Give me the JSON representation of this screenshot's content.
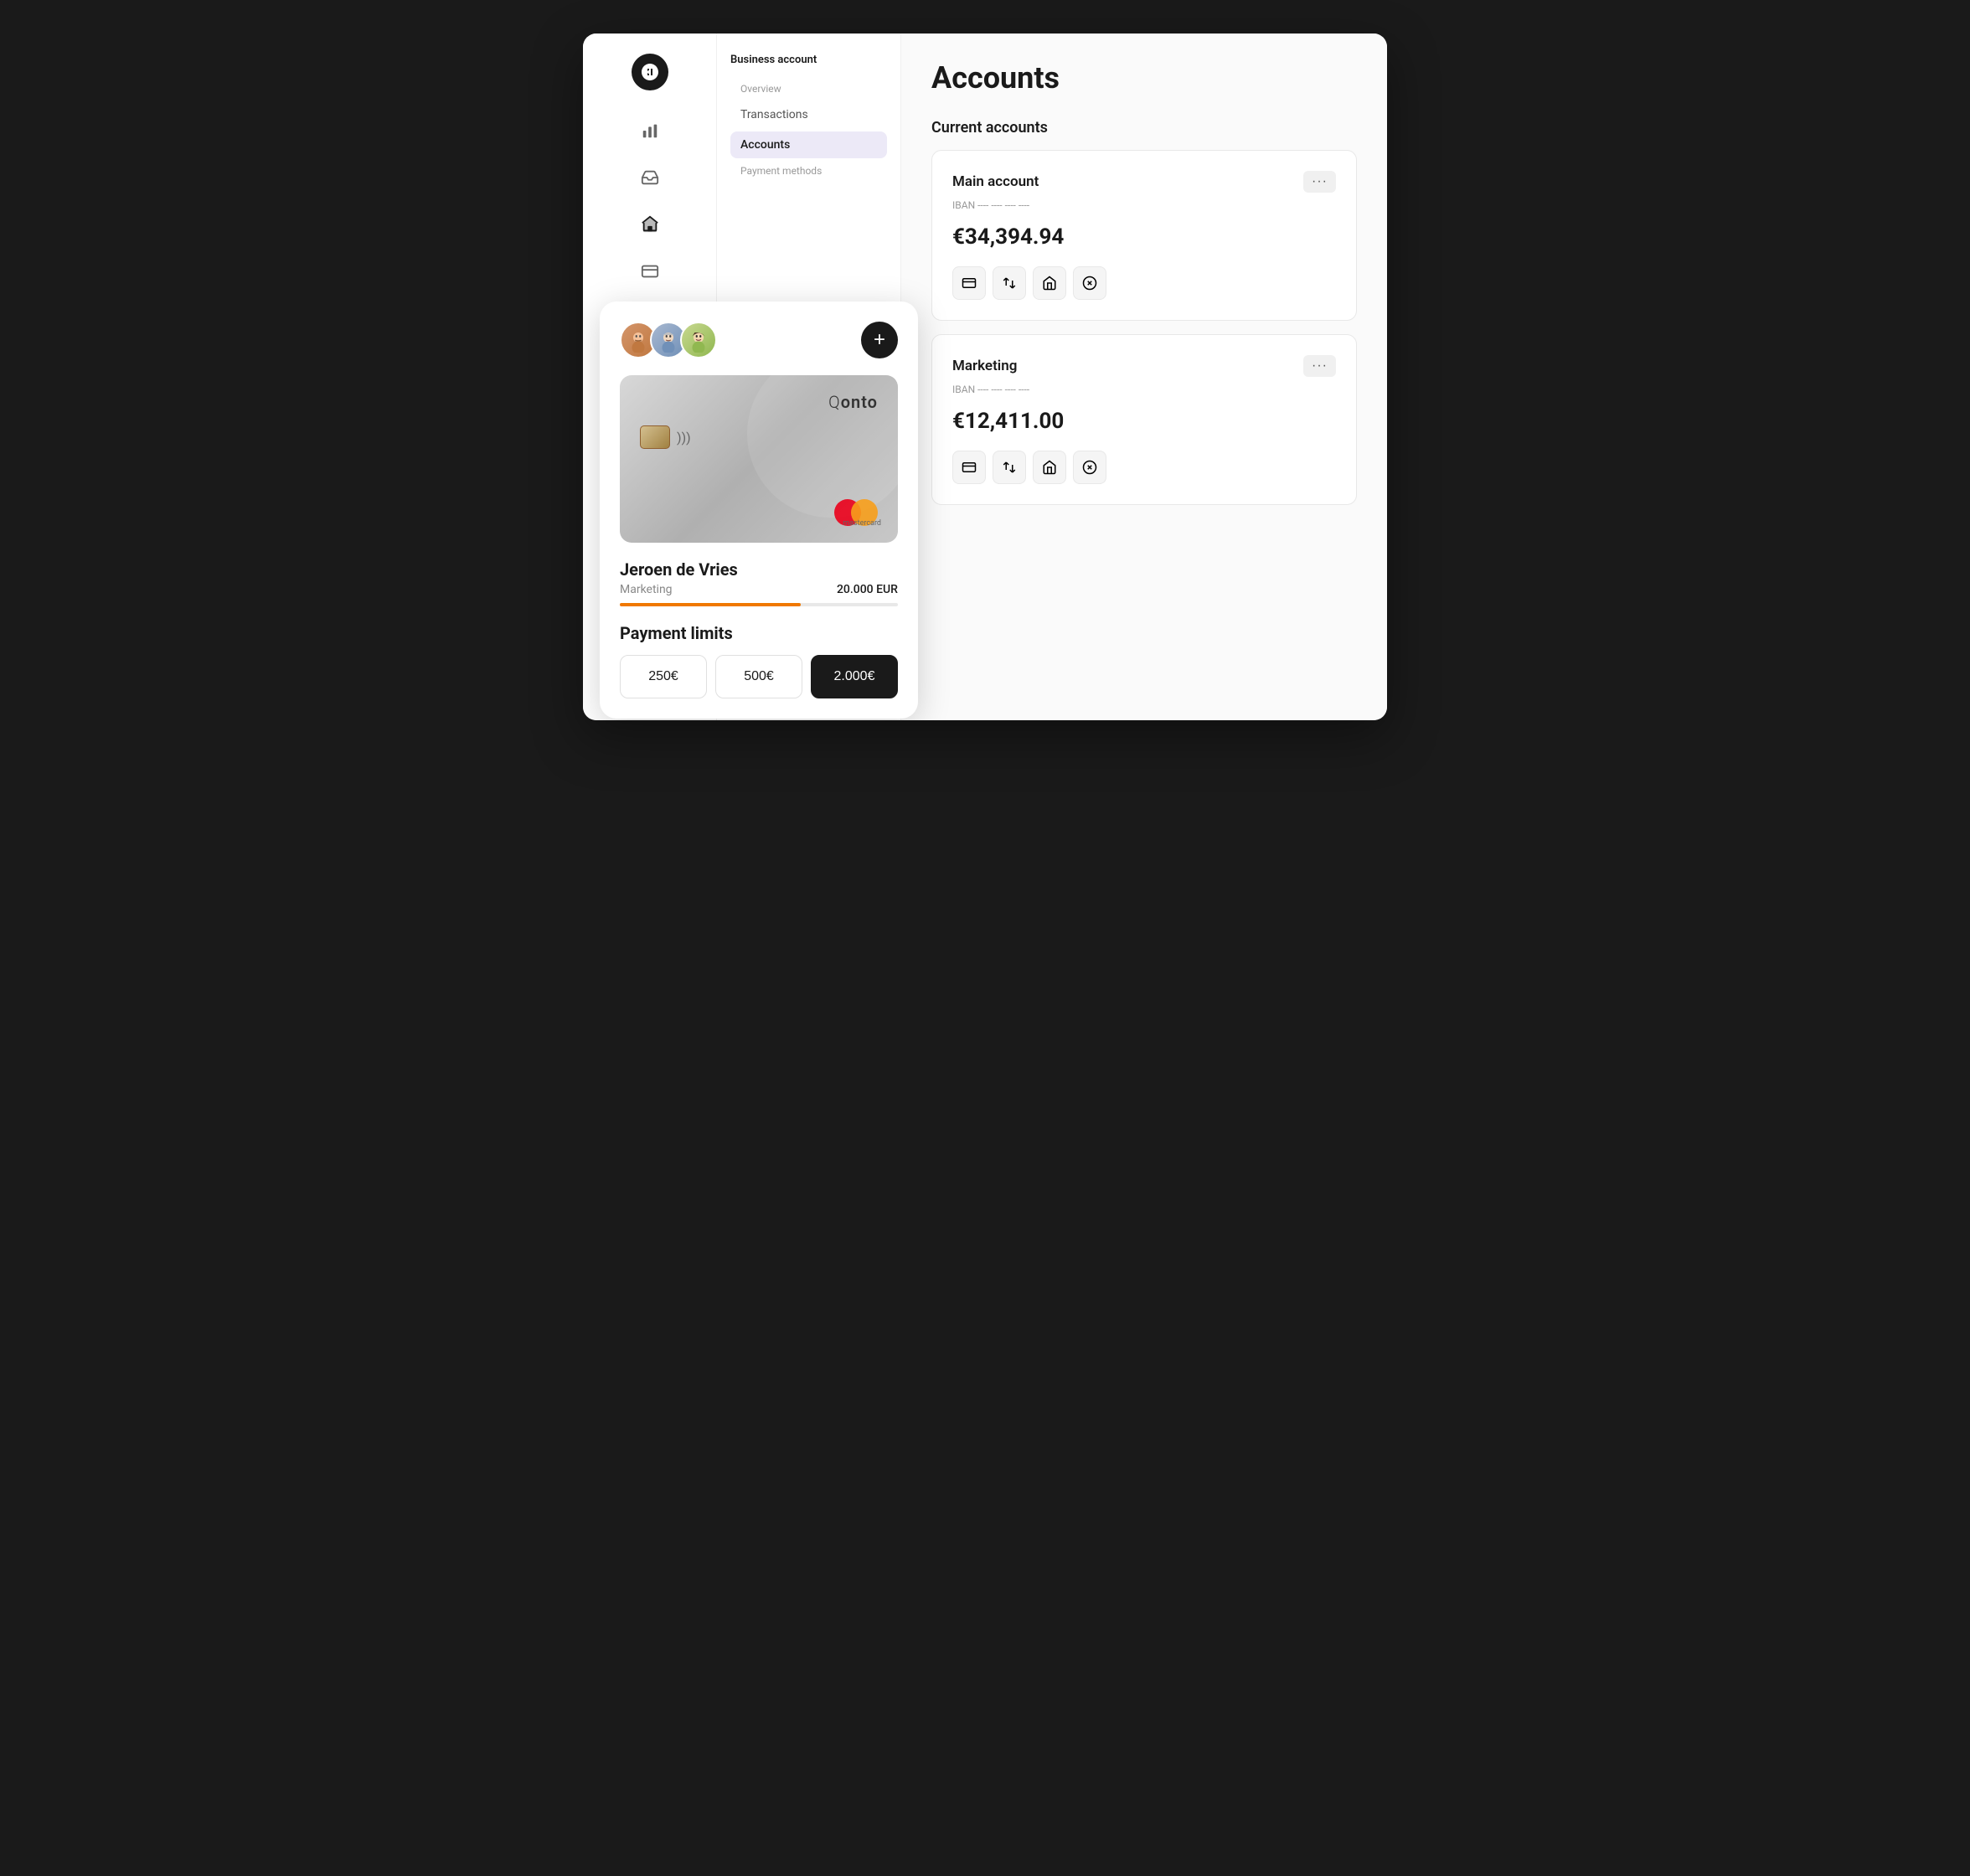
{
  "sidebar": {
    "logo_label": "Qonto logo",
    "items": [
      {
        "name": "analytics",
        "icon": "bar-chart",
        "active": false
      },
      {
        "name": "inbox",
        "icon": "inbox",
        "active": false
      },
      {
        "name": "accounts",
        "icon": "bank",
        "active": true
      },
      {
        "name": "cards",
        "icon": "card",
        "active": false
      }
    ]
  },
  "nav": {
    "section_title": "Business account",
    "items": [
      {
        "label": "Overview",
        "type": "label"
      },
      {
        "label": "Transactions",
        "active": false
      },
      {
        "label": "Accounts",
        "active": true
      },
      {
        "label": "Payment methods",
        "type": "label"
      }
    ]
  },
  "main": {
    "page_title": "Accounts",
    "section_title": "Current accounts",
    "accounts": [
      {
        "name": "Main account",
        "iban": "IBAN ---- ---- ---- ----",
        "balance": "€34,394.94",
        "actions": [
          "card",
          "transfer",
          "receive",
          "close"
        ]
      },
      {
        "name": "Marketing",
        "iban": "IBAN ---- ---- ---- ----",
        "balance": "€12,411.00",
        "actions": [
          "card",
          "transfer",
          "receive",
          "close"
        ]
      }
    ]
  },
  "card_panel": {
    "avatars": [
      {
        "label": "Person 1",
        "color": "#e8c89a"
      },
      {
        "label": "Person 2",
        "color": "#b8c8e8"
      },
      {
        "label": "Person 3",
        "color": "#c8e0a0"
      }
    ],
    "add_button_label": "+",
    "card": {
      "brand": "Qonto",
      "owner": "Jeroen de Vries",
      "department": "Marketing",
      "limit_amount": "20.000 EUR",
      "progress": 65,
      "network": "mastercard"
    },
    "payment_limits": {
      "title": "Payment limits",
      "options": [
        {
          "label": "250€",
          "active": false
        },
        {
          "label": "500€",
          "active": false
        },
        {
          "label": "2.000€",
          "active": true
        }
      ]
    }
  }
}
